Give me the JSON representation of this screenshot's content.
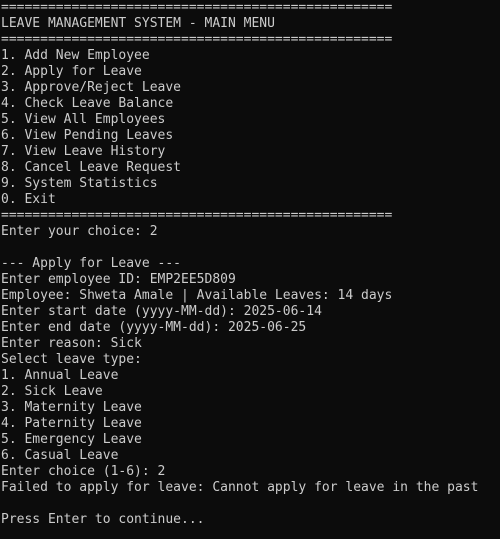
{
  "terminal": {
    "colors": {
      "background": "#0c0c0c",
      "text": "#cccccc"
    },
    "lines": [
      "==================================================",
      "LEAVE MANAGEMENT SYSTEM - MAIN MENU",
      "==================================================",
      "1. Add New Employee",
      "2. Apply for Leave",
      "3. Approve/Reject Leave",
      "4. Check Leave Balance",
      "5. View All Employees",
      "6. View Pending Leaves",
      "7. View Leave History",
      "8. Cancel Leave Request",
      "9. System Statistics",
      "0. Exit",
      "==================================================",
      "Enter your choice: 2",
      "",
      "--- Apply for Leave ---",
      "Enter employee ID: EMP2EE5D809",
      "Employee: Shweta Amale | Available Leaves: 14 days",
      "Enter start date (yyyy-MM-dd): 2025-06-14",
      "Enter end date (yyyy-MM-dd): 2025-06-25",
      "Enter reason: Sick",
      "Select leave type:",
      "1. Annual Leave",
      "2. Sick Leave",
      "3. Maternity Leave",
      "4. Paternity Leave",
      "5. Emergency Leave",
      "6. Casual Leave",
      "Enter choice (1-6): 2",
      "Failed to apply for leave: Cannot apply for leave in the past",
      "",
      "Press Enter to continue..."
    ]
  }
}
